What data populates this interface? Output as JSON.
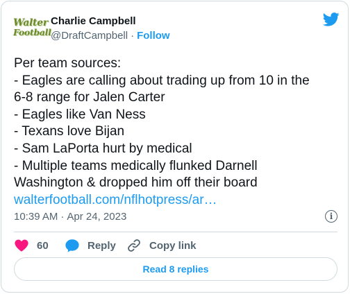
{
  "author": {
    "avatar_text_1": "Walter",
    "avatar_text_2": "Football",
    "name": "Charlie Campbell",
    "handle": "@DraftCampbell",
    "separator": "·",
    "follow_label": "Follow"
  },
  "tweet": {
    "lines": [
      "Per team sources:",
      "- Eagles are calling about trading up from 10 in the",
      "6-8 range for Jalen Carter",
      "- Eagles like Van Ness",
      "- Texans love Bijan",
      "- Sam LaPorta hurt by medical",
      "- Multiple teams medically flunked Darnell",
      "Washington & dropped him off their board"
    ],
    "link": "walterfootball.com/nflhotpress/ar…"
  },
  "meta": {
    "time": "10:39 AM",
    "separator": "·",
    "date": "Apr 24, 2023"
  },
  "actions": {
    "like_count": "60",
    "reply_label": "Reply",
    "copy_link_label": "Copy link"
  },
  "replies_button": "Read 8 replies",
  "colors": {
    "accent": "#1d9bf0",
    "like": "#f91880",
    "text": "#0f1419",
    "muted": "#536471",
    "border": "#cfd9de"
  },
  "icons": [
    "twitter-bird-icon",
    "info-icon",
    "heart-icon",
    "reply-icon",
    "link-icon"
  ]
}
